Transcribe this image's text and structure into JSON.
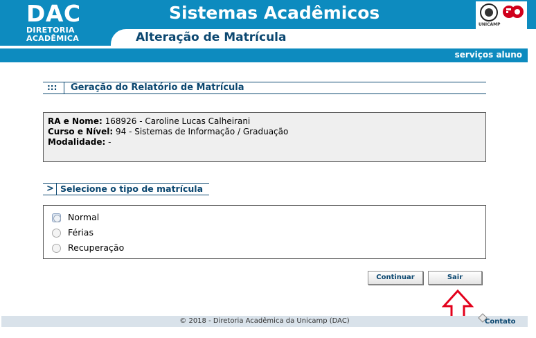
{
  "header": {
    "logo_main": "DAC",
    "logo_line1": "DIRETORIA",
    "logo_line2": "ACADÊMICA",
    "system_title": "Sistemas Acadêmicos",
    "page_subtitle": "Alteração de Matrícula",
    "unicamp_label": "UNICAMP"
  },
  "service_bar": {
    "link_label": "serviços aluno"
  },
  "report_section": {
    "marker": ":::",
    "title": "Geração do Relatório de Matrícula"
  },
  "student_info": {
    "ra_label": "RA e Nome:",
    "ra_value": " 168926 -  Caroline Lucas Calheirani",
    "course_label": "Curso e Nível:",
    "course_value": " 94 - Sistemas de Informação / Graduação",
    "modality_label": "Modalidade:",
    "modality_value": " -"
  },
  "select_section": {
    "marker": ">",
    "title": "Selecione o tipo de matrícula"
  },
  "options": [
    {
      "label": "Normal"
    },
    {
      "label": "Férias"
    },
    {
      "label": "Recuperação"
    }
  ],
  "buttons": {
    "continue_label": "Continuar",
    "exit_label": "Sair"
  },
  "footer": {
    "copyright": "© 2018 - Diretoria Acadêmica da Unicamp (DAC)",
    "contact_label": "Contato"
  },
  "colors": {
    "header_blue": "#0d8bbf",
    "title_navy": "#0b4770",
    "annotation_red": "#e3001b"
  }
}
